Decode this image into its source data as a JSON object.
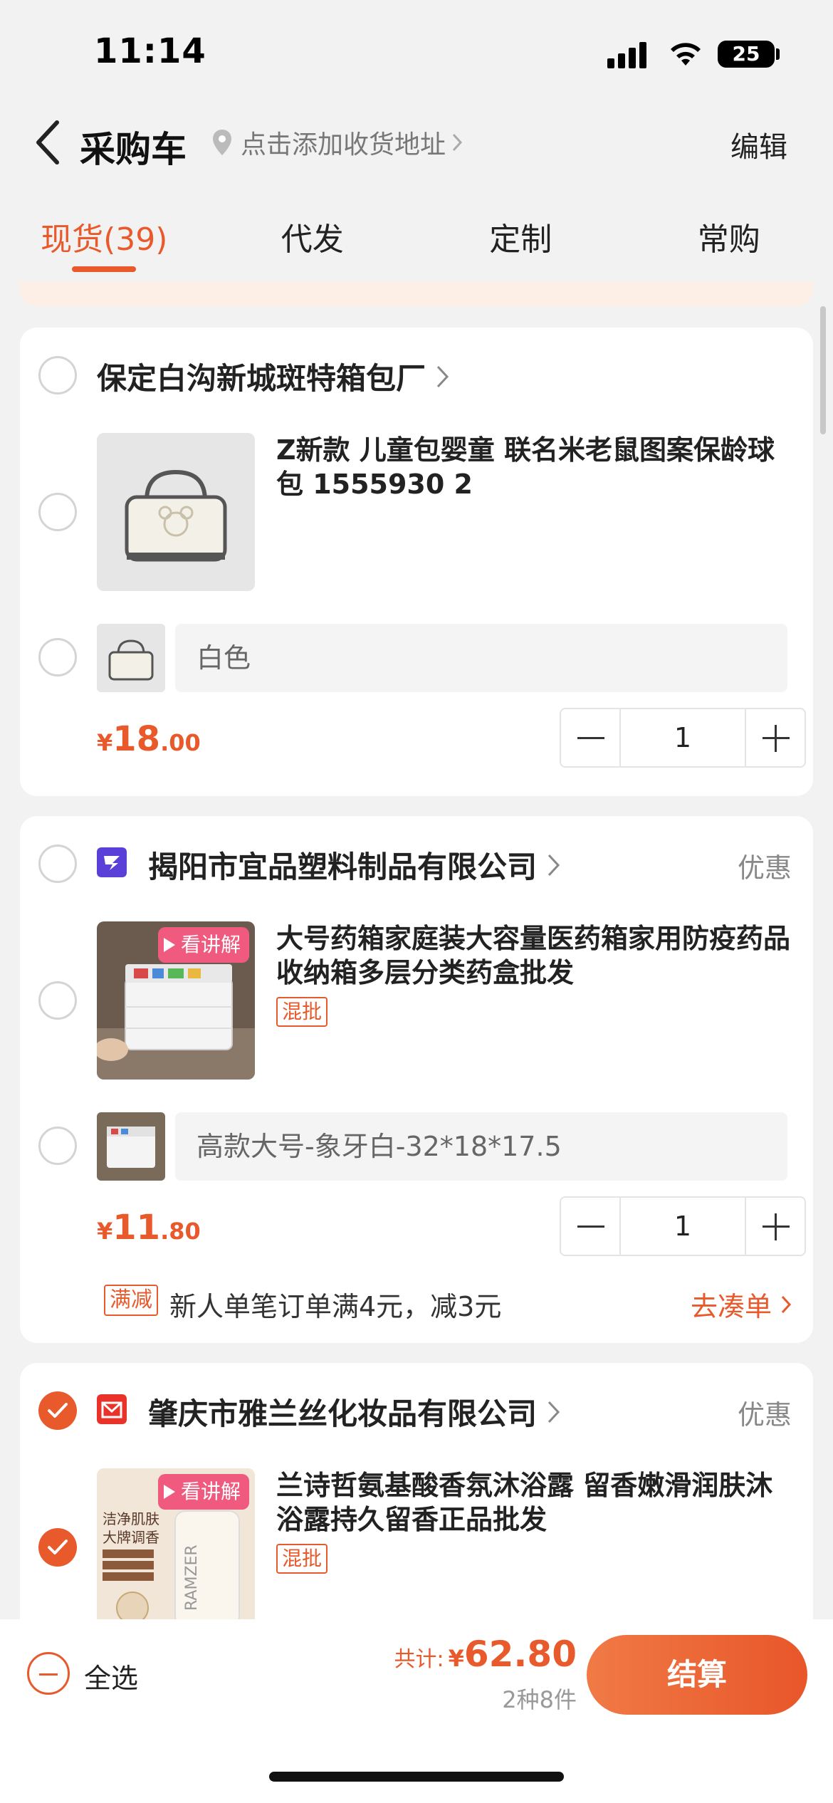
{
  "status_bar": {
    "time": "11:14",
    "battery": "25"
  },
  "nav": {
    "title": "采购车",
    "address": "点击添加收货地址",
    "edit": "编辑"
  },
  "tabs": [
    {
      "label": "现货(39)",
      "active": true
    },
    {
      "label": "代发",
      "active": false
    },
    {
      "label": "定制",
      "active": false
    },
    {
      "label": "常购",
      "active": false
    }
  ],
  "shops": [
    {
      "name": "保定白沟新城斑特箱包厂",
      "checked": false,
      "product": {
        "title": "Z新款 儿童包婴童 联名米老鼠图案保龄球包 1555930 2",
        "sku": "白色",
        "price_yen": "¥",
        "price_int": "18",
        "price_dec": ".00",
        "qty": "1"
      }
    },
    {
      "name": "揭阳市宜品塑料制品有限公司",
      "discount": "优惠",
      "checked": false,
      "product": {
        "badge": "看讲解",
        "title": "大号药箱家庭装大容量医药箱家用防疫药品收纳箱多层分类药盒批发",
        "tag": "混批",
        "sku": "高款大号-象牙白-32*18*17.5",
        "price_yen": "¥",
        "price_int": "11",
        "price_dec": ".80",
        "qty": "1"
      },
      "promo": {
        "tag": "满减",
        "text": "新人单笔订单满4元，减3元",
        "link": "去凑单"
      }
    },
    {
      "name": "肇庆市雅兰丝化妆品有限公司",
      "discount": "优惠",
      "checked": true,
      "product": {
        "badge": "看讲解",
        "title": "兰诗哲氨基酸香氛沐浴露 留香嫩滑润肤沐浴露持久留香正品批发",
        "tag": "混批",
        "img_text1": "洁净肌肤",
        "img_text2": "大牌调香",
        "img_brand": "RAMZER"
      }
    }
  ],
  "bottom_bar": {
    "select_all": "全选",
    "total_label": "共计:",
    "total_yen": "¥",
    "total_value": "62.80",
    "count": "2种8件",
    "checkout": "结算"
  },
  "colors": {
    "accent": "#e85a2c",
    "background": "#f2f2f2",
    "card": "#ffffff"
  }
}
